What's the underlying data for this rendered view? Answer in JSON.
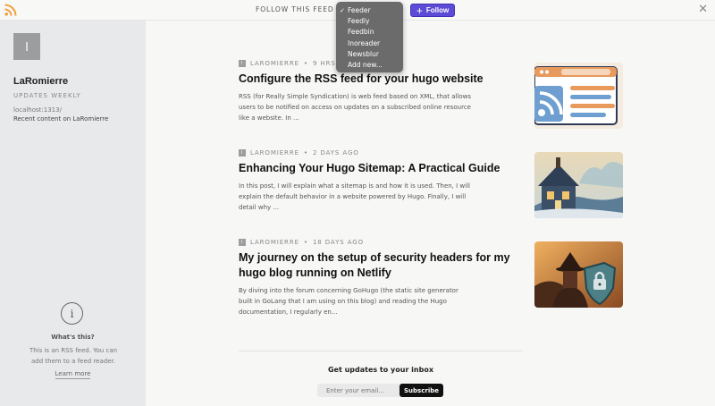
{
  "topbar": {
    "follow_label": "FOLLOW THIS FEED WITH",
    "selected_reader": "Feeder",
    "follow_button": "Follow",
    "close_glyph": "✕"
  },
  "reader_options": [
    "Feeder",
    "Feedly",
    "Feedbin",
    "Inoreader",
    "Newsblur",
    "Add new..."
  ],
  "sidebar": {
    "avatar_letter": "l",
    "title": "LaRomierre",
    "subtitle": "UPDATES WEEKLY",
    "url": "localhost:1313/",
    "description": "Recent content on LaRomierre",
    "info_glyph": "i",
    "whats_this": "What's this?",
    "whats_desc": "This is an RSS feed. You can add them to a feed reader.",
    "learn_more": "Learn more"
  },
  "posts": [
    {
      "author": "LAROMIERRE",
      "time": "9 HRS AGO",
      "title": "Configure the RSS feed for your hugo website",
      "excerpt": "RSS (for Really Simple Syndication) is web feed based on XML, that allows users to be notified on access on updates on a subscribed online resource like a website. In ...",
      "thumb_icon": "rss-illustration-icon"
    },
    {
      "author": "LAROMIERRE",
      "time": "2 DAYS AGO",
      "title": "Enhancing Your Hugo Sitemap: A Practical Guide",
      "excerpt": "In this post, I will explain what a sitemap is and how it is used. Then, I will explain the default behavior in a website powered by Hugo. Finally, I will detail why ...",
      "thumb_icon": "house-illustration-icon"
    },
    {
      "author": "LAROMIERRE",
      "time": "18 DAYS AGO",
      "title": "My journey on the setup of security headers for my hugo blog running on Netlify",
      "excerpt": "By diving into the forum concerning GoHugo (the static site generator built in GoLang that I am using on this blog) and reading the Hugo documentation, I regularly en...",
      "thumb_icon": "knight-shield-illustration-icon"
    }
  ],
  "newsletter": {
    "title": "Get updates to your inbox",
    "placeholder": "Enter your email...",
    "button": "Subscribe"
  },
  "colors": {
    "accent": "#5b4bd6",
    "rss_orange": "#f0a040",
    "sidebar_bg": "#e8e9ea",
    "dropdown_bg": "#6b6b6b"
  }
}
